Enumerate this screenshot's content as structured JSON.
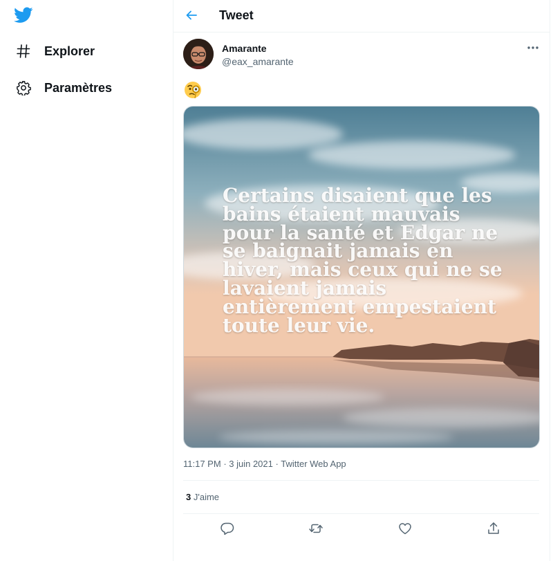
{
  "sidebar": {
    "logo_icon": "twitter-bird-icon",
    "brand_color": "#1d9bf0",
    "items": [
      {
        "label": "Explorer",
        "icon": "hashtag-icon"
      },
      {
        "label": "Paramètres",
        "icon": "gear-icon"
      }
    ]
  },
  "header": {
    "back_icon": "arrow-left-icon",
    "title": "Tweet"
  },
  "tweet": {
    "author": {
      "name": "Amarante",
      "handle": "@eax_amarante"
    },
    "text_emoji": "🧐",
    "media_text": "Certains disaient que les bains étaient mauvais pour la santé et Edgar ne se baignait jamais en hiver, mais ceux qui ne se lavaient jamais entièrement empestaient toute leur vie.",
    "time": "11:17 PM",
    "date": "3 juin 2021",
    "source": "Twitter Web App",
    "likes_count": "3",
    "likes_label": "J'aime",
    "actions": [
      "reply-icon",
      "retweet-icon",
      "like-icon",
      "share-icon"
    ]
  }
}
